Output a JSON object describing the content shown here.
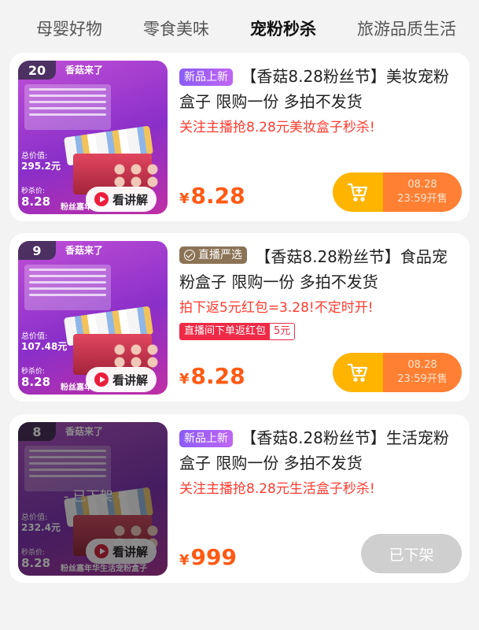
{
  "tabs": [
    {
      "label": "母婴好物"
    },
    {
      "label": "零食美味"
    },
    {
      "label": "宠粉秒杀",
      "active": true
    },
    {
      "label": "旅游品质生活"
    }
  ],
  "products": [
    {
      "rank": "20",
      "brand_text": "香菇来了",
      "thumb_total_label": "总价值:",
      "thumb_total_value": "295.2元",
      "thumb_sec_label": "秒杀价:",
      "thumb_price": "8.28",
      "thumb_caption": "粉丝嘉年华美妆宠粉盒子",
      "watch_label": "看讲解",
      "badge": "新品上新",
      "title": "【香菇8.28粉丝节】美妆宠粉盒子 限购一份 多拍不发货",
      "subtitle": "关注主播抢8.28元美妆盒子秒杀!",
      "currency": "¥",
      "price": "8.28",
      "button_date": "08.28",
      "button_time": "23:59开售"
    },
    {
      "rank": "9",
      "brand_text": "香菇来了",
      "thumb_total_label": "总价值:",
      "thumb_total_value": "107.48元",
      "thumb_sec_label": "秒杀价:",
      "thumb_price": "8.28",
      "thumb_caption": "粉丝嘉年华零食宠粉盒子",
      "watch_label": "看讲解",
      "badge": "直播严选",
      "title": "【香菇8.28粉丝节】食品宠粉盒子 限购一份 多拍不发货",
      "subtitle": "拍下返5元红包=3.28!不定时开!",
      "coupon_left": "直播间下单返红包",
      "coupon_right": "5元",
      "currency": "¥",
      "price": "8.28",
      "button_date": "08.28",
      "button_time": "23:59开售"
    },
    {
      "rank": "8",
      "brand_text": "香菇来了",
      "overlay": "- 已下架 -",
      "thumb_total_label": "总价值:",
      "thumb_total_value": "232.4元",
      "thumb_sec_label": "秒杀价:",
      "thumb_price": "8.28",
      "thumb_caption": "粉丝嘉年华生活宠粉盒子",
      "watch_label": "看讲解",
      "badge": "新品上新",
      "title": "【香菇8.28粉丝节】生活宠粉盒子 限购一份 多拍不发货",
      "subtitle": "关注主播抢8.28元生活盒子秒杀!",
      "currency": "¥",
      "price": "999",
      "button_label": "已下架"
    }
  ],
  "colors": {
    "price": "#ff5a14",
    "subtitle": "#ff3b2f",
    "cart_btn": "#ffb400",
    "time_btn": "#ff7f33",
    "delisted_btn": "#cfcfcf"
  },
  "icons": [
    "play-icon",
    "cart-add-icon",
    "check-icon"
  ]
}
